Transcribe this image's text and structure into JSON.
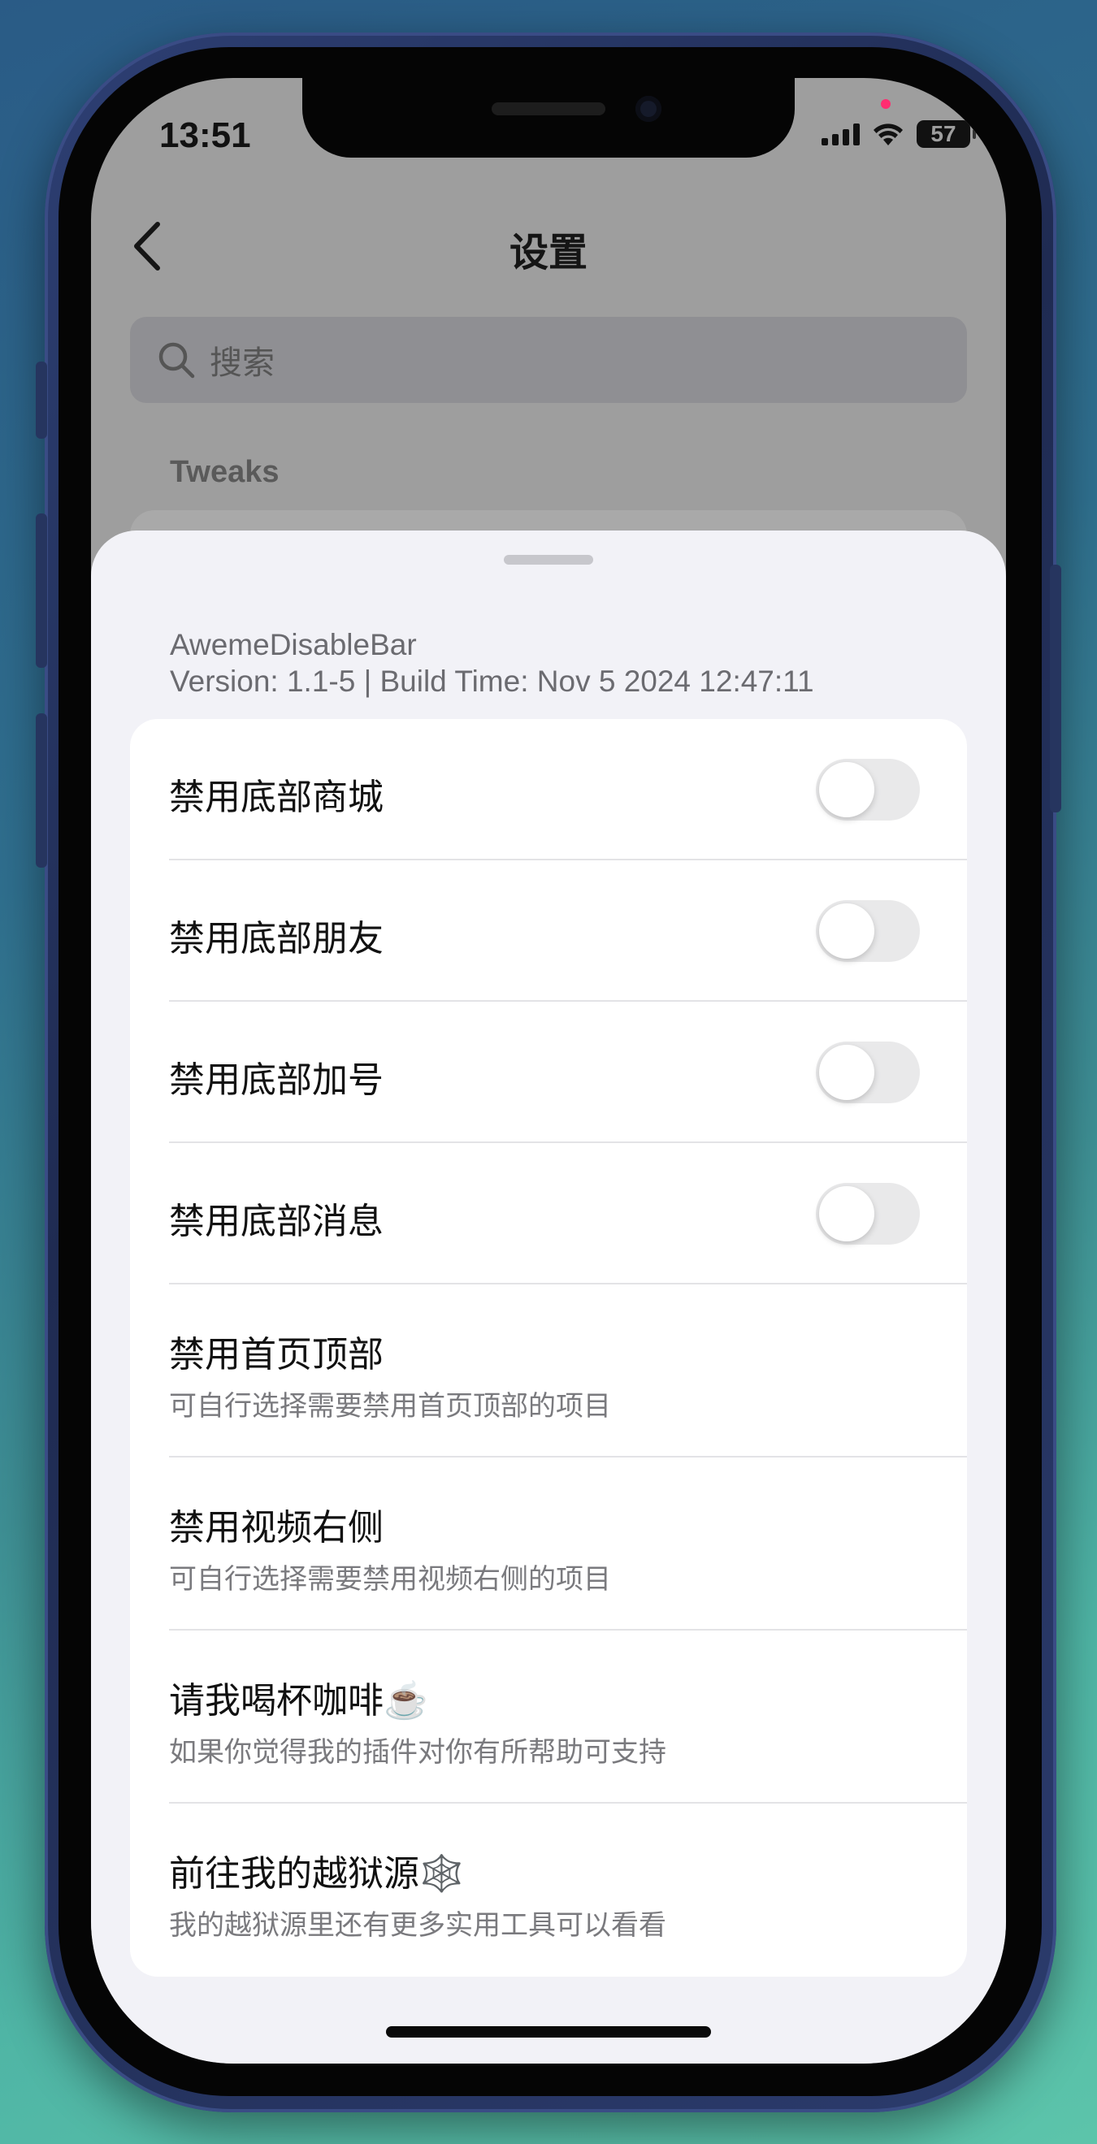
{
  "status_bar": {
    "time": "13:51",
    "battery": "57"
  },
  "nav": {
    "title": "设置"
  },
  "search": {
    "placeholder": "搜索"
  },
  "section": {
    "label": "Tweaks"
  },
  "sheet": {
    "app_name": "AwemeDisableBar",
    "version_line": "Version: 1.1-5 | Build Time: Nov  5 2024 12:47:11",
    "rows": [
      {
        "label": "禁用底部商城",
        "toggle": false
      },
      {
        "label": "禁用底部朋友",
        "toggle": false
      },
      {
        "label": "禁用底部加号",
        "toggle": false
      },
      {
        "label": "禁用底部消息",
        "toggle": false
      },
      {
        "label": "禁用首页顶部",
        "subtitle": "可自行选择需要禁用首页顶部的项目"
      },
      {
        "label": "禁用视频右侧",
        "subtitle": "可自行选择需要禁用视频右侧的项目"
      },
      {
        "label": "请我喝杯咖啡☕️",
        "subtitle": "如果你觉得我的插件对你有所帮助可支持"
      },
      {
        "label": "前往我的越狱源🕸️",
        "subtitle": "我的越狱源里还有更多实用工具可以看看"
      }
    ]
  },
  "colors": {
    "background_start": "#2a5b86",
    "background_end": "#5cc4aa",
    "toggle_off": "#e9e9ea"
  }
}
